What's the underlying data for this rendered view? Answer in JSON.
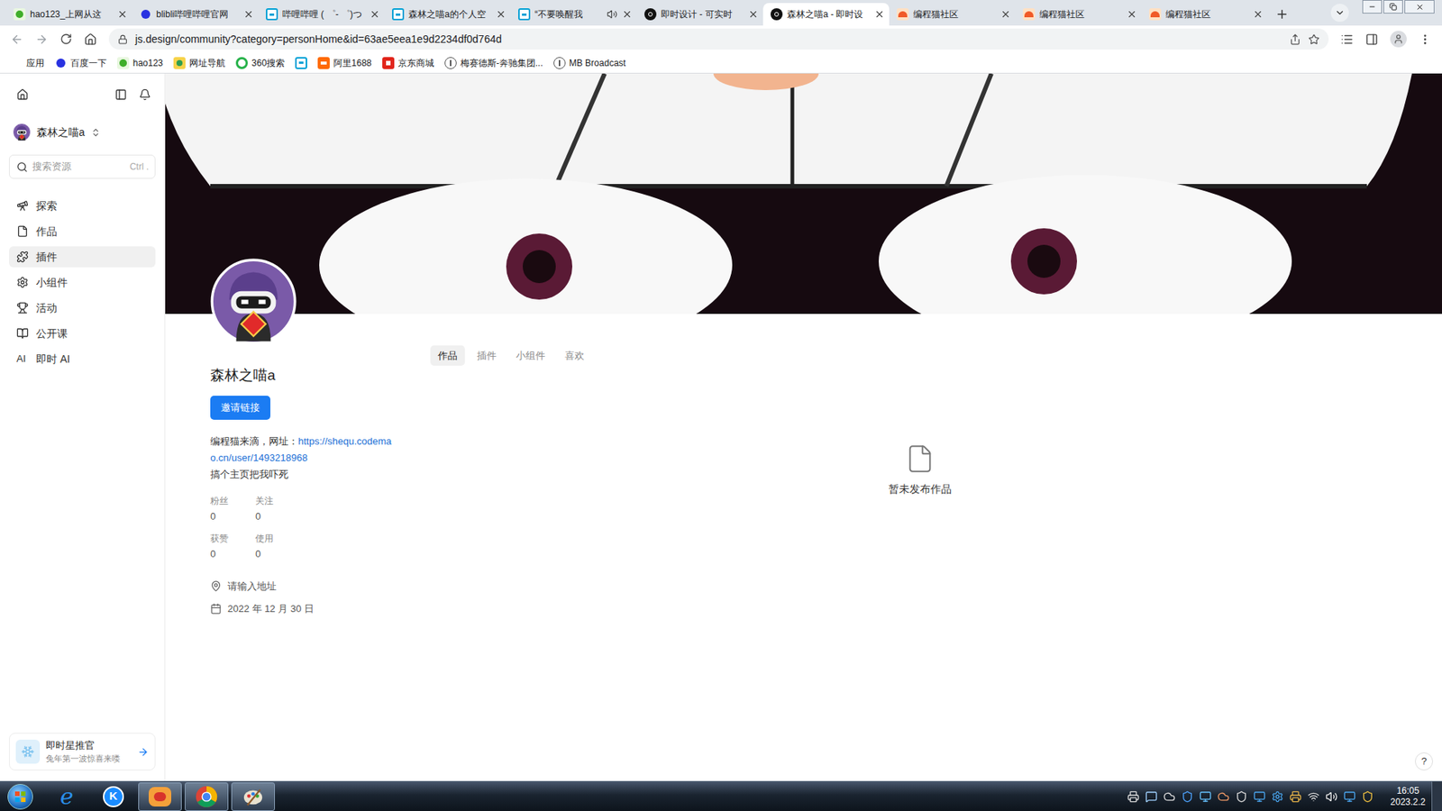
{
  "browser": {
    "tabs": [
      {
        "title": "hao123_上网从这",
        "kind": "hao123",
        "selected": false,
        "audio": false
      },
      {
        "title": "blibli哔哩哔哩官网",
        "kind": "baidu",
        "selected": false,
        "audio": false
      },
      {
        "title": "哔哩哔哩 ( ゜- ゜)つ",
        "kind": "bilibili",
        "selected": false,
        "audio": false
      },
      {
        "title": "森林之喵a的个人空",
        "kind": "bilibili",
        "selected": false,
        "audio": false
      },
      {
        "title": "“不要唤醒我",
        "kind": "bilibili",
        "selected": false,
        "audio": true
      },
      {
        "title": "即时设计 - 可实时",
        "kind": "jsdesign",
        "selected": false,
        "audio": false
      },
      {
        "title": "森林之喵a - 即时设",
        "kind": "jsdesign",
        "selected": true,
        "audio": false
      },
      {
        "title": "编程猫社区",
        "kind": "codemao",
        "selected": false,
        "audio": false
      },
      {
        "title": "编程猫社区",
        "kind": "codemao",
        "selected": false,
        "audio": false
      },
      {
        "title": "编程猫社区",
        "kind": "codemao",
        "selected": false,
        "audio": false
      }
    ],
    "address": "js.design/community?category=personHome&id=63ae5eea1e9d2234df0d764d",
    "bookmarks": [
      {
        "label": "应用",
        "kind": "apps"
      },
      {
        "label": "百度一下",
        "kind": "baidu"
      },
      {
        "label": "hao123",
        "kind": "hao123"
      },
      {
        "label": "网址导航",
        "kind": "nav"
      },
      {
        "label": "360搜索",
        "kind": "s360"
      },
      {
        "label": "",
        "kind": "bilibili"
      },
      {
        "label": "阿里1688",
        "kind": "ali"
      },
      {
        "label": "京东商城",
        "kind": "jd"
      },
      {
        "label": "梅赛德斯-奔驰集团...",
        "kind": "benz"
      },
      {
        "label": "MB Broadcast",
        "kind": "benz"
      }
    ]
  },
  "sidebar": {
    "user": "森林之喵a",
    "search": {
      "placeholder": "搜索资源",
      "shortcut": "Ctrl ."
    },
    "items": [
      {
        "label": "探索",
        "selected": false,
        "icon_text": ""
      },
      {
        "label": "作品",
        "selected": false,
        "icon_text": ""
      },
      {
        "label": "插件",
        "selected": true,
        "icon_text": ""
      },
      {
        "label": "小组件",
        "selected": false,
        "icon_text": ""
      },
      {
        "label": "活动",
        "selected": false,
        "icon_text": ""
      },
      {
        "label": "公开课",
        "selected": false,
        "icon_text": ""
      },
      {
        "label": "即时 AI",
        "selected": false,
        "icon_text": "AI"
      }
    ],
    "promo": {
      "title": "即时星推官",
      "subtitle": "兔年第一波惊喜来喽"
    }
  },
  "profile": {
    "name": "森林之喵a",
    "invite_button": "邀请链接",
    "bio_prefix": "编程猫来滴，网址：",
    "bio_link": "https://shequ.codemao.cn/user/1493218968",
    "bio_suffix": "搞个主页把我吓死",
    "stats": [
      {
        "label": "粉丝",
        "value": "0"
      },
      {
        "label": "关注",
        "value": "0"
      },
      {
        "label": "获赞",
        "value": "0"
      },
      {
        "label": "使用",
        "value": "0"
      }
    ],
    "location": "请输入地址",
    "joined": "2022 年 12 月 30 日"
  },
  "content_tabs": [
    {
      "label": "作品",
      "selected": true
    },
    {
      "label": "插件",
      "selected": false
    },
    {
      "label": "小组件",
      "selected": false
    },
    {
      "label": "喜欢",
      "selected": false
    }
  ],
  "empty_state": "暂未发布作品",
  "help": "?",
  "taskbar": {
    "apps": [
      {
        "kind": "ie",
        "running": false,
        "glyph": "e"
      },
      {
        "kind": "kugou",
        "running": false,
        "glyph": "K"
      },
      {
        "kind": "codemao",
        "running": true,
        "glyph": ""
      },
      {
        "kind": "chrome",
        "running": true,
        "glyph": ""
      },
      {
        "kind": "paint",
        "running": true,
        "glyph": ""
      }
    ],
    "time": "16:05",
    "date": "2023.2.2"
  }
}
